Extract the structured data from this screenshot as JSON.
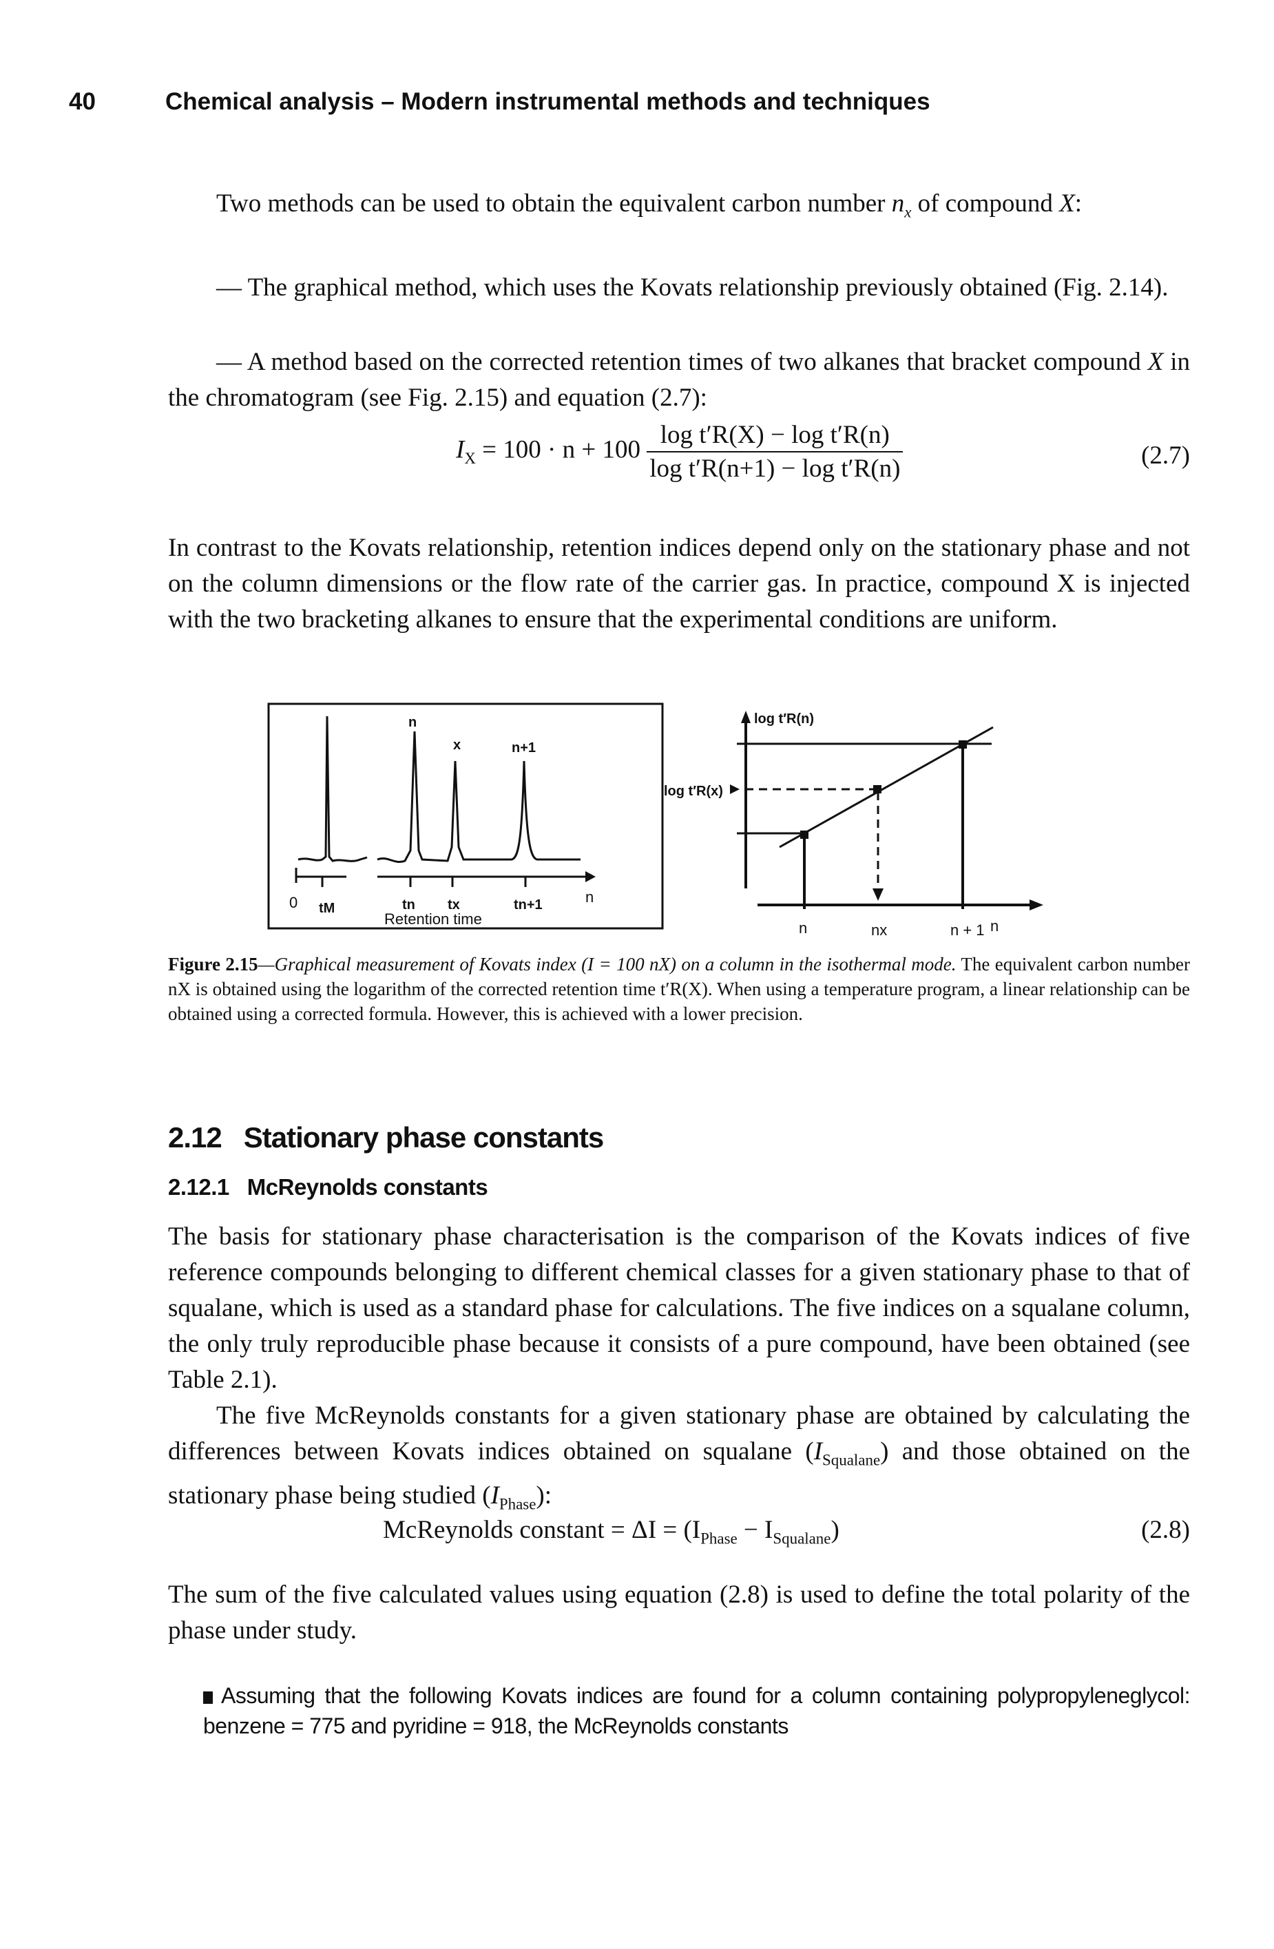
{
  "header": {
    "page_number": "40",
    "running_title": "Chemical analysis – Modern instrumental methods and techniques"
  },
  "intro": {
    "p1_a": "Two methods can be used to obtain the equivalent carbon number ",
    "p1_var": "n",
    "p1_sub": "x",
    "p1_b": " of compound ",
    "p1_X": "X",
    "p1_c": ":",
    "item1": "— The graphical method, which uses the Kovats relationship previously obtained (Fig. 2.14).",
    "item2_a": "— A method based on the corrected retention times of two alkanes that bracket compound ",
    "item2_X": "X",
    "item2_b": " in the chromatogram (see Fig. 2.15) and equation (2.7):"
  },
  "equation_2_7": {
    "lhs": "I",
    "lhs_sub": "X",
    "middle": " = 100 · n + 100",
    "num": "log t′R(X) − log t′R(n)",
    "den": "log t′R(n+1) − log t′R(n)",
    "number": "(2.7)"
  },
  "paragraph2": "In contrast to the Kovats relationship, retention indices depend only on the stationary phase and not on the column dimensions or the flow rate of the carrier gas. In practice, compound X is injected with the two bracketing alkanes to ensure that the experimental conditions are uniform.",
  "figure": {
    "chromatogram": {
      "peak_labels": [
        "n",
        "x",
        "n+1"
      ],
      "axis_labels": [
        "0",
        "tM",
        "tn",
        "tx",
        "tn+1",
        "n"
      ],
      "xlabel": "Retention time"
    },
    "plot": {
      "ylabel": "log t′R(n)",
      "y_marker": "log t′R(x)",
      "x_labels": [
        "n",
        "nx",
        "n + 1",
        "n"
      ]
    },
    "caption_label": "Figure 2.15",
    "caption_italic": "—Graphical measurement of Kovats index (I = 100 nX) on a column in the isothermal mode.",
    "caption_rest": " The equivalent carbon number nX is obtained using the logarithm of the corrected retention time t′R(X). When using a temperature program, a linear relationship can be obtained using a corrected formula. However, this is achieved with a lower precision."
  },
  "section": {
    "h2_number": "2.12",
    "h2_title": "Stationary phase constants",
    "h3_number": "2.12.1",
    "h3_title": "McReynolds constants"
  },
  "paragraph3": "The basis for stationary phase characterisation is the comparison of the Kovats indices of five reference compounds belonging to different chemical classes for a given stationary phase to that of squalane, which is used as a standard phase for calculations. The five indices on a squalane column, the only truly reproducible phase because it consists of a pure compound, have been obtained (see Table 2.1).",
  "paragraph4_a": "The five McReynolds constants for a given stationary phase are obtained by calculating the differences between Kovats indices obtained on squalane (",
  "paragraph4_sq": "Squalane",
  "paragraph4_b": ") and those obtained on the stationary phase being studied (",
  "paragraph4_ph": "Phase",
  "paragraph4_c": "):",
  "equation_2_8": {
    "text": "McReynolds constant = ΔI = (I",
    "sub1": "Phase",
    "minus": " − I",
    "sub2": "Squalane",
    "close": ")",
    "number": "(2.8)"
  },
  "paragraph5": "The sum of the five calculated values using equation (2.8) is used to define the total polarity of the phase under study.",
  "exercise": "Assuming that the following Kovats indices are found for a column containing polypropyleneglycol: benzene = 775 and pyridine = 918, the McReynolds constants"
}
